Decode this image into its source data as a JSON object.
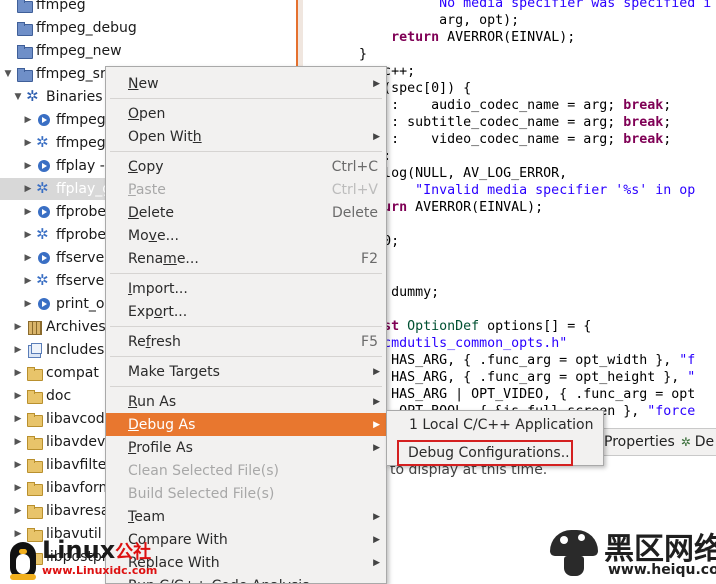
{
  "tree": {
    "items": [
      {
        "label": "ffmpeg",
        "icon": "project-folder-icon",
        "twisty": ""
      },
      {
        "label": "ffmpeg_debug",
        "icon": "project-folder-icon",
        "twisty": ""
      },
      {
        "label": "ffmpeg_new",
        "icon": "project-folder-icon",
        "twisty": ""
      },
      {
        "label": "ffmpeg_src",
        "icon": "project-folder-icon",
        "twisty": "▼"
      },
      {
        "label": "Binaries",
        "icon": "binaries-icon",
        "twisty": "▼"
      },
      {
        "label": "ffmpeg",
        "icon": "binary-run-icon",
        "twisty": "▶"
      },
      {
        "label": "ffmpeg",
        "icon": "binary-gear-icon",
        "twisty": "▶"
      },
      {
        "label": "ffplay -",
        "icon": "binary-run-icon",
        "twisty": "▶"
      },
      {
        "label": "ffplay_g",
        "icon": "binary-gear-icon",
        "twisty": "▶"
      },
      {
        "label": "ffprobe",
        "icon": "binary-run-icon",
        "twisty": "▶"
      },
      {
        "label": "ffprobe",
        "icon": "binary-gear-icon",
        "twisty": "▶"
      },
      {
        "label": "ffserver",
        "icon": "binary-run-icon",
        "twisty": "▶"
      },
      {
        "label": "ffserver",
        "icon": "binary-gear-icon",
        "twisty": "▶"
      },
      {
        "label": "print_o",
        "icon": "binary-run-icon",
        "twisty": "▶"
      },
      {
        "label": "Archives",
        "icon": "archives-icon",
        "twisty": "▶"
      },
      {
        "label": "Includes",
        "icon": "includes-icon",
        "twisty": "▶"
      },
      {
        "label": "compat",
        "icon": "folder-icon",
        "twisty": "▶"
      },
      {
        "label": "doc",
        "icon": "folder-icon",
        "twisty": "▶"
      },
      {
        "label": "libavcode",
        "icon": "folder-icon",
        "twisty": "▶"
      },
      {
        "label": "libavdevi",
        "icon": "folder-icon",
        "twisty": "▶"
      },
      {
        "label": "libavfilter",
        "icon": "folder-icon",
        "twisty": "▶"
      },
      {
        "label": "libavform",
        "icon": "folder-icon",
        "twisty": "▶"
      },
      {
        "label": "libavresa",
        "icon": "folder-icon",
        "twisty": "▶"
      },
      {
        "label": "libavutil",
        "icon": "folder-icon",
        "twisty": "▶"
      },
      {
        "label": "libpostpr",
        "icon": "folder-icon",
        "twisty": "▶"
      }
    ]
  },
  "editor": {
    "lines": [
      [
        {
          "t": "                  "
        },
        {
          "t": "No media specifier was specified i",
          "c": "str"
        }
      ],
      [
        {
          "t": "                  arg, opt);"
        }
      ],
      [
        {
          "t": "            "
        },
        {
          "t": "return",
          "c": "kw"
        },
        {
          "t": " AVERROR(EINVAL);"
        }
      ],
      [
        {
          "t": "        }"
        }
      ],
      [
        {
          "t": "        spec++;"
        }
      ],
      [
        {
          "t": "        "
        },
        {
          "t": "ch",
          "c": "kw"
        },
        {
          "t": " (spec[0]) {"
        }
      ],
      [
        {
          "t": "        "
        },
        {
          "t": "'a'",
          "c": "str"
        },
        {
          "t": " :    audio_codec_name = arg; "
        },
        {
          "t": "break",
          "c": "kw"
        },
        {
          "t": ";"
        }
      ],
      [
        {
          "t": "        "
        },
        {
          "t": "'s'",
          "c": "str"
        },
        {
          "t": " : subtitle_codec_name = arg; "
        },
        {
          "t": "break",
          "c": "kw"
        },
        {
          "t": ";"
        }
      ],
      [
        {
          "t": "        "
        },
        {
          "t": "'v'",
          "c": "str"
        },
        {
          "t": " :    video_codec_name = arg; "
        },
        {
          "t": "break",
          "c": "kw"
        },
        {
          "t": ";"
        }
      ],
      [
        {
          "t": "        "
        },
        {
          "t": "ult",
          "c": "kw"
        },
        {
          "t": ":"
        }
      ],
      [
        {
          "t": "        av_log(NULL, AV_LOG_ERROR,"
        }
      ],
      [
        {
          "t": "               "
        },
        {
          "t": "\"Invalid media specifier '%s' in op",
          "c": "str"
        }
      ],
      [
        {
          "t": "        "
        },
        {
          "t": "return",
          "c": "kw"
        },
        {
          "t": " AVERROR(EINVAL);"
        }
      ],
      [
        {
          "t": ""
        }
      ],
      [
        {
          "t": "        "
        },
        {
          "t": "rn",
          "c": "kw"
        },
        {
          "t": " 0;"
        }
      ],
      [
        {
          "t": ""
        }
      ],
      [
        {
          "t": ""
        }
      ],
      [
        {
          "t": "        "
        },
        {
          "t": "int",
          "c": "kw"
        },
        {
          "t": " dummy;"
        }
      ],
      [
        {
          "t": ""
        }
      ],
      [
        {
          "t": "        "
        },
        {
          "t": "const",
          "c": "kw"
        },
        {
          "t": " "
        },
        {
          "t": "OptionDef",
          "c": "ty"
        },
        {
          "t": " options[] = {"
        }
      ],
      [
        {
          "t": "        "
        },
        {
          "t": "e",
          "c": "kw"
        },
        {
          "t": " "
        },
        {
          "t": "\"cmdutils_common_opts.h\"",
          "c": "str"
        }
      ],
      [
        {
          "t": "        "
        },
        {
          "t": "x\"",
          "c": "str"
        },
        {
          "t": ", HAS_ARG, { .func_arg = opt_width }, "
        },
        {
          "t": "\"f",
          "c": "str"
        }
      ],
      [
        {
          "t": "        "
        },
        {
          "t": "y\"",
          "c": "str"
        },
        {
          "t": ", HAS_ARG, { .func_arg = opt_height }, "
        },
        {
          "t": "\"",
          "c": "str"
        }
      ],
      [
        {
          "t": "        "
        },
        {
          "t": "s\"",
          "c": "str"
        },
        {
          "t": ", HAS_ARG | OPT_VIDEO, { .func_arg = opt"
        }
      ],
      [
        {
          "t": "        "
        },
        {
          "t": "fs\"",
          "c": "str"
        },
        {
          "t": ", OPT_BOOL, { &is_full_screen }, "
        },
        {
          "t": "\"force",
          "c": "str"
        }
      ]
    ]
  },
  "bottom": {
    "tab_properties": "Properties",
    "tab_debug": "De",
    "message": "to display at this time."
  },
  "menu": {
    "items": [
      {
        "kind": "item",
        "pre": "",
        "u": "N",
        "post": "ew",
        "shortcut": "",
        "submenu": true,
        "disabled": false,
        "active": false,
        "name": "menu-new"
      },
      {
        "kind": "sep"
      },
      {
        "kind": "item",
        "pre": "",
        "u": "O",
        "post": "pen",
        "shortcut": "",
        "submenu": false,
        "disabled": false,
        "active": false,
        "name": "menu-open"
      },
      {
        "kind": "item",
        "pre": "Open Wit",
        "u": "h",
        "post": "",
        "shortcut": "",
        "submenu": true,
        "disabled": false,
        "active": false,
        "name": "menu-open-with"
      },
      {
        "kind": "sep"
      },
      {
        "kind": "item",
        "pre": "",
        "u": "C",
        "post": "opy",
        "shortcut": "Ctrl+C",
        "submenu": false,
        "disabled": false,
        "active": false,
        "name": "menu-copy"
      },
      {
        "kind": "item",
        "pre": "",
        "u": "P",
        "post": "aste",
        "shortcut": "Ctrl+V",
        "submenu": false,
        "disabled": true,
        "active": false,
        "name": "menu-paste"
      },
      {
        "kind": "item",
        "pre": "",
        "u": "D",
        "post": "elete",
        "shortcut": "Delete",
        "submenu": false,
        "disabled": false,
        "active": false,
        "name": "menu-delete"
      },
      {
        "kind": "item",
        "pre": "Mo",
        "u": "v",
        "post": "e...",
        "shortcut": "",
        "submenu": false,
        "disabled": false,
        "active": false,
        "name": "menu-move"
      },
      {
        "kind": "item",
        "pre": "Rena",
        "u": "m",
        "post": "e...",
        "shortcut": "F2",
        "submenu": false,
        "disabled": false,
        "active": false,
        "name": "menu-rename"
      },
      {
        "kind": "sep"
      },
      {
        "kind": "item",
        "pre": "",
        "u": "I",
        "post": "mport...",
        "shortcut": "",
        "submenu": false,
        "disabled": false,
        "active": false,
        "name": "menu-import"
      },
      {
        "kind": "item",
        "pre": "Exp",
        "u": "o",
        "post": "rt...",
        "shortcut": "",
        "submenu": false,
        "disabled": false,
        "active": false,
        "name": "menu-export"
      },
      {
        "kind": "sep"
      },
      {
        "kind": "item",
        "pre": "Re",
        "u": "f",
        "post": "resh",
        "shortcut": "F5",
        "submenu": false,
        "disabled": false,
        "active": false,
        "name": "menu-refresh"
      },
      {
        "kind": "sep"
      },
      {
        "kind": "item",
        "pre": "Make Targets",
        "u": "",
        "post": "",
        "shortcut": "",
        "submenu": true,
        "disabled": false,
        "active": false,
        "name": "menu-make-targets"
      },
      {
        "kind": "sep"
      },
      {
        "kind": "item",
        "pre": "",
        "u": "R",
        "post": "un As",
        "shortcut": "",
        "submenu": true,
        "disabled": false,
        "active": false,
        "name": "menu-run-as"
      },
      {
        "kind": "item",
        "pre": "",
        "u": "D",
        "post": "ebug As",
        "shortcut": "",
        "submenu": true,
        "disabled": false,
        "active": true,
        "name": "menu-debug-as"
      },
      {
        "kind": "item",
        "pre": "",
        "u": "P",
        "post": "rofile As",
        "shortcut": "",
        "submenu": true,
        "disabled": false,
        "active": false,
        "name": "menu-profile-as"
      },
      {
        "kind": "item",
        "pre": "Clean Selected File(s)",
        "u": "",
        "post": "",
        "shortcut": "",
        "submenu": false,
        "disabled": true,
        "active": false,
        "name": "menu-clean-selected"
      },
      {
        "kind": "item",
        "pre": "Build Selected File(s)",
        "u": "",
        "post": "",
        "shortcut": "",
        "submenu": false,
        "disabled": true,
        "active": false,
        "name": "menu-build-selected"
      },
      {
        "kind": "item",
        "pre": "",
        "u": "T",
        "post": "eam",
        "shortcut": "",
        "submenu": true,
        "disabled": false,
        "active": false,
        "name": "menu-team"
      },
      {
        "kind": "item",
        "pre": "Compare With",
        "u": "",
        "post": "",
        "shortcut": "",
        "submenu": true,
        "disabled": false,
        "active": false,
        "name": "menu-compare-with"
      },
      {
        "kind": "item",
        "pre": "Replace With",
        "u": "",
        "post": "",
        "shortcut": "",
        "submenu": true,
        "disabled": false,
        "active": false,
        "name": "menu-replace-with"
      },
      {
        "kind": "item",
        "pre": "Run C/C++ Code Analysis",
        "u": "",
        "post": "",
        "shortcut": "",
        "submenu": false,
        "disabled": false,
        "active": false,
        "name": "menu-run-code-analysis"
      }
    ]
  },
  "submenu": {
    "items": [
      {
        "label": "1 Local C/C++ Application",
        "name": "submenu-local-cpp-app"
      },
      {
        "label": "Debug Configurations...",
        "name": "submenu-debug-configurations"
      }
    ]
  },
  "watermarks": {
    "linux_text": "Linux",
    "linux_cn": "公社",
    "linux_url": "www.Linuxidc.com",
    "heiqu_cn": "黑区网络",
    "heiqu_url": "www.heiqu.com"
  },
  "colors": {
    "accent": "#e8772f",
    "highlight_box": "#d42020",
    "keyword": "#7f0055",
    "string": "#2a00ff"
  }
}
